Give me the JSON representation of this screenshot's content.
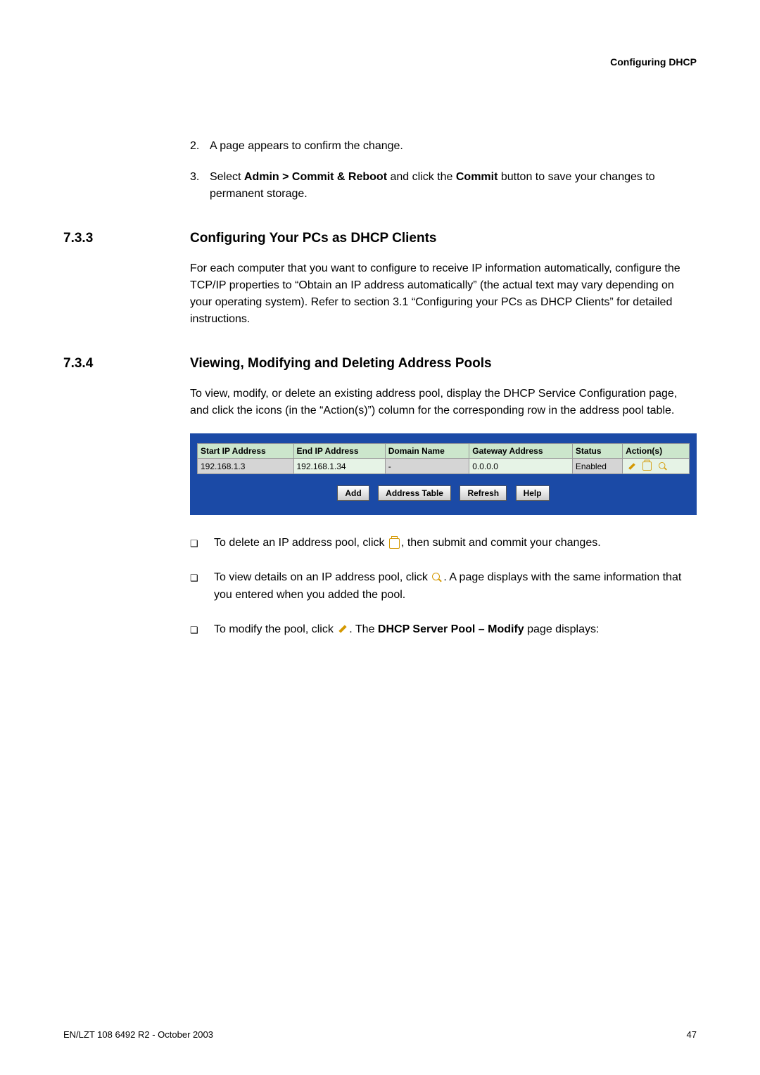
{
  "header": {
    "title": "Configuring DHCP"
  },
  "step2": {
    "num": "2.",
    "text": "A page appears to confirm the change."
  },
  "step3": {
    "num": "3.",
    "prefix": "Select ",
    "bold1": "Admin > Commit & Reboot",
    "mid": " and click the ",
    "bold2": "Commit",
    "suffix": " button to save your changes to permanent storage."
  },
  "sec733": {
    "num": "7.3.3",
    "title": "Configuring Your PCs as DHCP Clients",
    "para": "For each computer that you want to configure to receive IP information automatically, configure the TCP/IP properties to “Obtain an IP address automatically” (the actual text may vary depending on your operating system). Refer to section 3.1 “Configuring your PCs as DHCP Clients” for detailed instructions."
  },
  "sec734": {
    "num": "7.3.4",
    "title": "Viewing, Modifying and Deleting Address Pools",
    "para": "To view, modify, or delete an existing address pool, display the DHCP Service Configuration page, and click the icons (in the “Action(s)”) column for the corresponding row in the address pool table."
  },
  "table": {
    "headers": [
      "Start IP Address",
      "End IP Address",
      "Domain Name",
      "Gateway Address",
      "Status",
      "Action(s)"
    ],
    "row": {
      "start": "192.168.1.3",
      "end": "192.168.1.34",
      "domain": "-",
      "gateway": "0.0.0.0",
      "status": "Enabled"
    },
    "buttons": {
      "add": "Add",
      "addr": "Address Table",
      "refresh": "Refresh",
      "help": "Help"
    }
  },
  "bullets": {
    "b1a": "To delete an IP address pool, click ",
    "b1b": ", then submit and commit your changes.",
    "b2a": "To view details on an IP address pool, click ",
    "b2b": ". A page displays with the same information that you entered when you added the pool.",
    "b3a": "To modify the pool, click ",
    "b3b": ". The ",
    "b3bold": "DHCP Server Pool – Modify",
    "b3c": " page displays:"
  },
  "footer": {
    "left": "EN/LZT 108 6492 R2 - October 2003",
    "right": "47"
  }
}
